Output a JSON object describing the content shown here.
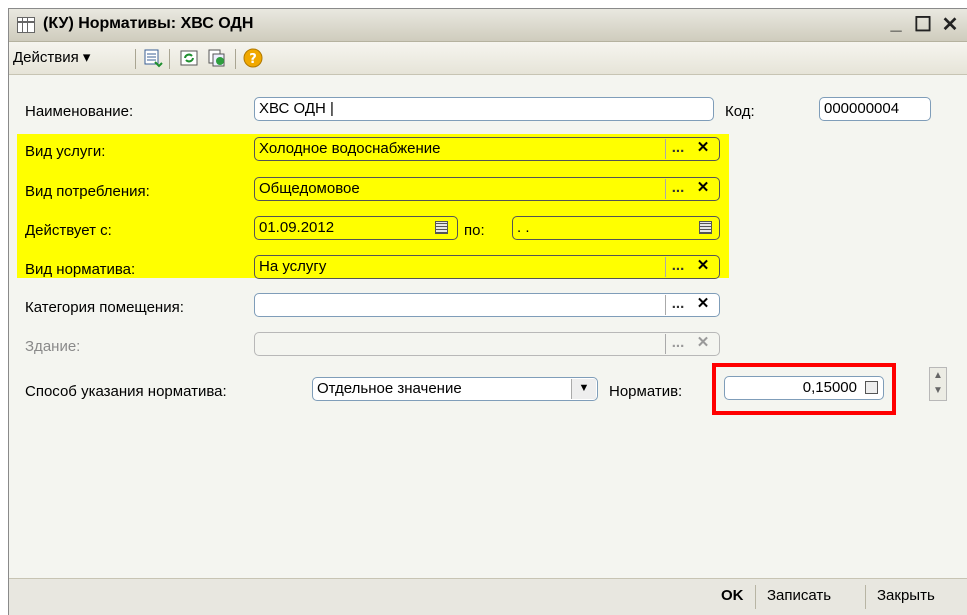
{
  "window": {
    "title": "(КУ) Нормативы: ХВС ОДН",
    "minimize": "_",
    "maximize": "☐",
    "close": "✕"
  },
  "toolbar": {
    "actions_label": "Действия ▾",
    "icons": [
      "save-list-icon",
      "refresh-icon",
      "copy-icon",
      "help-icon"
    ],
    "help_glyph": "?"
  },
  "form": {
    "name_label": "Наименование:",
    "name_value": "ХВС ОДН |",
    "code_label": "Код:",
    "code_value": "000000004",
    "service_label": "Вид услуги:",
    "service_value": "Холодное водоснабжение",
    "consumption_label": "Вид потребления:",
    "consumption_value": "Общедомовое",
    "valid_from_label": "Действует с:",
    "valid_from_value": "01.09.2012",
    "valid_to_label": "по:",
    "valid_to_value": " .  .",
    "norm_kind_label": "Вид норматива:",
    "norm_kind_value": "На услугу",
    "room_category_label": "Категория помещения:",
    "room_category_value": "",
    "building_label": "Здание:",
    "building_value": "",
    "method_label": "Способ указания норматива:",
    "method_value": "Отдельное значение",
    "norm_label": "Норматив:",
    "norm_value": "0,15000",
    "dots": "...",
    "clear": "✕",
    "dropdown": "▼"
  },
  "highlight_color": "#ffff00",
  "emphasis_color": "#ff0000",
  "buttons": {
    "ok": "OK",
    "save": "Записать",
    "close": "Закрыть"
  }
}
